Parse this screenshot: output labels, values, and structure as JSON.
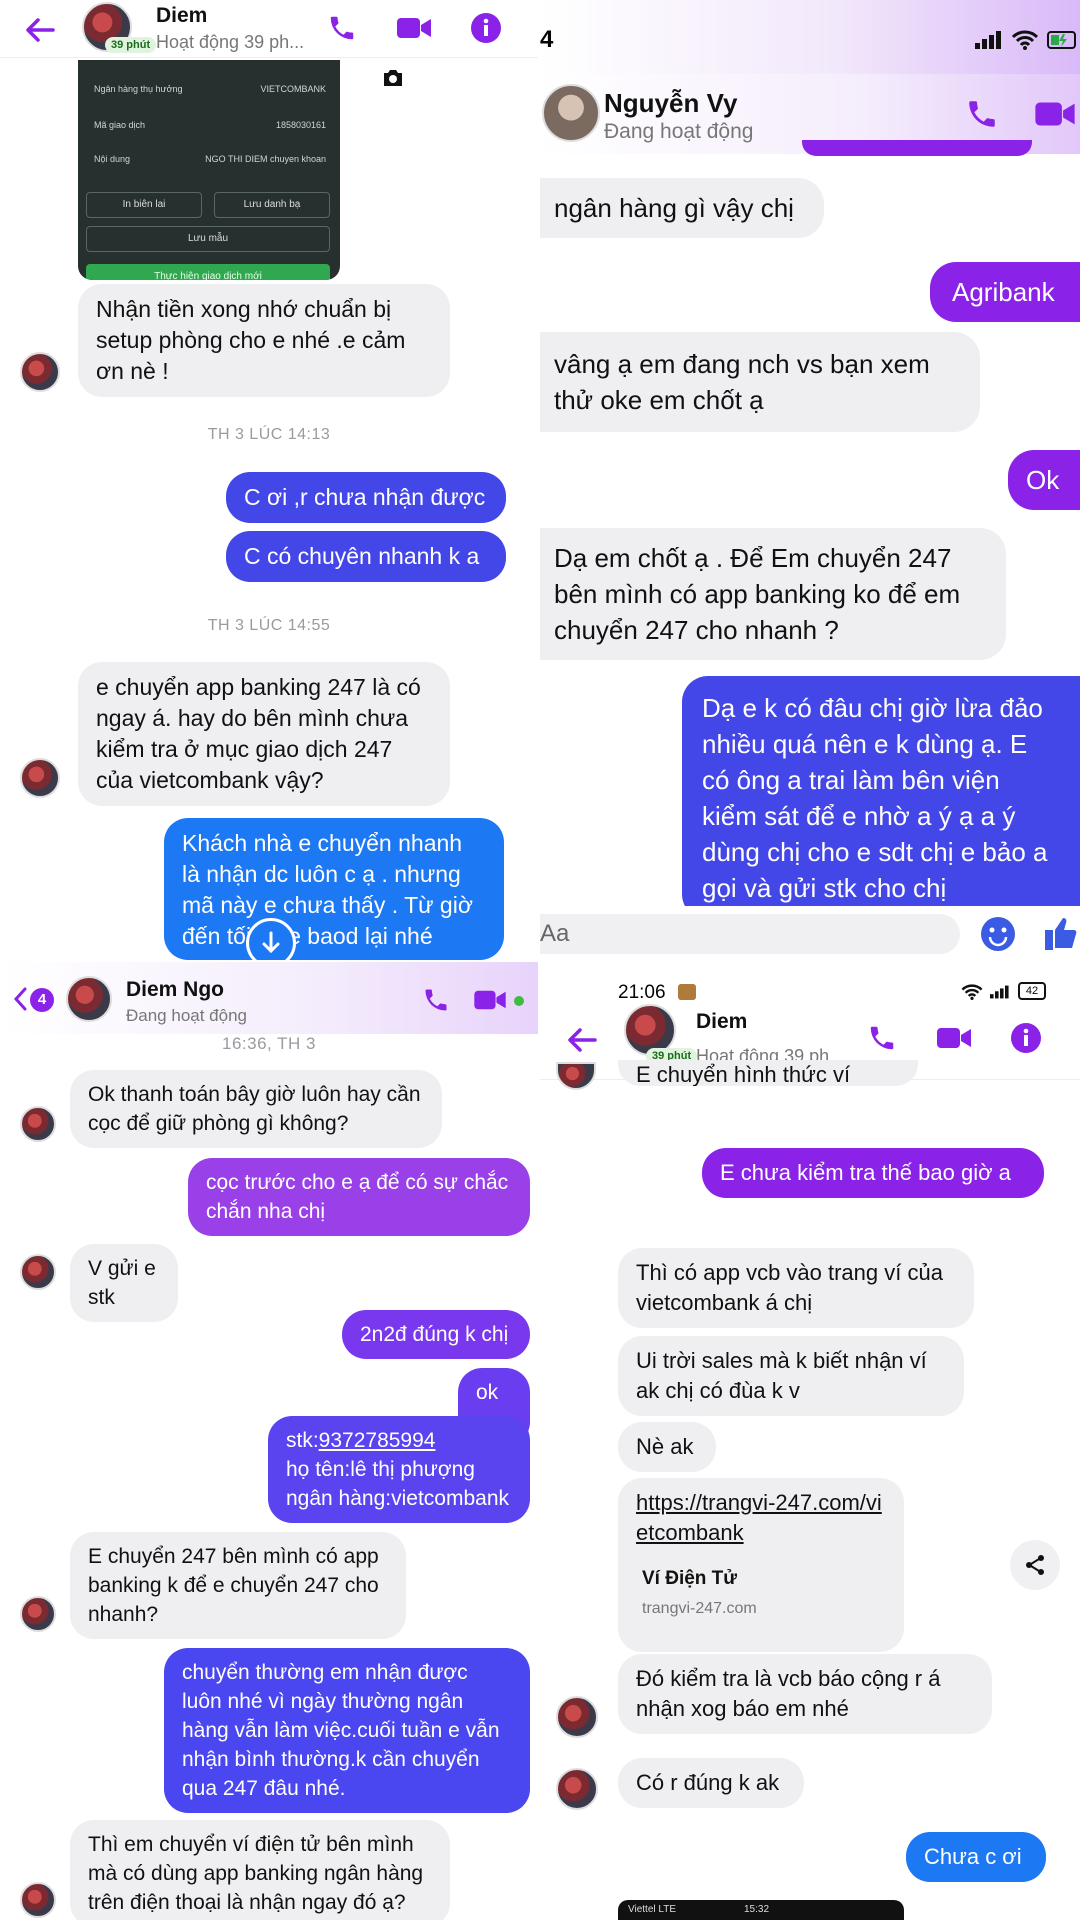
{
  "p1": {
    "header": {
      "name": "Diem",
      "badge": "39 phút",
      "status": "Hoạt động 39 ph..."
    },
    "receipt": {
      "rows": [
        {
          "label": "Ngân hàng thụ hưởng",
          "value": "VIETCOMBANK"
        },
        {
          "label": "Mã giao dịch",
          "value": "1858030161"
        },
        {
          "label": "Nội dung",
          "value": "NGO THI DIEM chuyen khoan"
        }
      ],
      "btn_reprint": "In biên lai",
      "btn_save_contact": "Lưu danh bạ",
      "btn_save_template": "Lưu mẫu",
      "btn_new": "Thực hiện giao dịch mới"
    },
    "messages": {
      "m1": "Nhận tiền xong nhớ chuẩn bị setup phòng cho e nhé .e cảm ơn nè !",
      "t1": "TH 3 LÚC 14:13",
      "m2": "C ơi ,r chưa nhận được",
      "m3": "C có chuyên nhanh k a",
      "t2": "TH 3 LÚC 14:55",
      "m4": "e chuyển app banking 247 là có ngay á. hay do bên mình chưa kiểm tra ở mục giao dịch 247 của vietcombank vậy?",
      "m5": "Khách nhà e chuyển nhanh là nhận dc luôn c ạ . nhưng mã này e chưa thấy . Từ giờ đến tối ấy e baod lại nhé"
    }
  },
  "p2": {
    "status_time": "4",
    "header": {
      "name": "Nguyễn Vy",
      "status": "Đang hoạt động"
    },
    "messages": {
      "m1": "ngân hàng gì vậy chị",
      "m2": "Agribank",
      "m3": "vâng ạ em đang nch vs bạn xem thử oke em chốt ạ",
      "m4": "Ok",
      "m5": "Dạ em chốt ạ . Để Em chuyển 247 bên mình có app banking ko để em chuyển 247 cho nhanh ?",
      "m6": "Dạ e k có đâu chị giờ lừa đảo nhiều quá nên e k dùng ạ. E có ông a trai làm bên viện kiểm sát để e nhờ a ý ạ a ý dùng chị cho e sdt chị e bảo a gọi và gửi stk cho chị"
    },
    "input_placeholder": "Aa"
  },
  "p3": {
    "header": {
      "back_count": "4",
      "name": "Diem Ngo",
      "status": "Đang hoạt động"
    },
    "messages": {
      "t1": "16:36, TH 3",
      "m1": "Ok thanh toán bây giờ luôn hay cần cọc để giữ phòng gì không?",
      "m2": "cọc trước cho e ạ để có sự chắc chắn nha chị",
      "m3": "V gửi e stk",
      "m4": "2n2đ đúng k chị",
      "m5": "ok c",
      "m6_prefix": "stk:",
      "m6_account": "9372785994",
      "m6_name": "họ tên:lê thị phượng",
      "m6_bank": "ngân hàng:vietcombank",
      "m7": "E chuyển 247 bên mình có app banking k để e chuyển 247 cho nhanh?",
      "m8": "chuyển thường em nhận được luôn nhé vì ngày thường ngân hàng vẫn làm việc.cuối tuần e vẫn nhận bình thường.k cần chuyển qua 247 đâu nhé.",
      "m9": "Thì em chuyển ví điện tử bên mình mà có dùng app banking ngân hàng trên điện thoại là nhận ngay đó ạ?"
    }
  },
  "p4": {
    "status_time": "21:06",
    "battery": "42",
    "header": {
      "name": "Diem",
      "badge": "39 phút",
      "status": "Hoạt động 39 ph..."
    },
    "messages": {
      "m0": "E chuyển hình thức ví",
      "m1": "E chưa kiểm tra thế bao giờ a",
      "m2": "Thì có app vcb vào trang ví của vietcombank á chị",
      "m3": "Ui trời sales mà k biết nhận ví ak chị có đùa k v",
      "m4": "Nè ak",
      "m5_link": "https://trangvi-247.com/vietcombank",
      "m5_title": "Ví Điện Tử",
      "m5_domain": "trangvi-247.com",
      "m6": "Đó kiểm tra là vcb báo cộng r á nhận xog báo em nhé",
      "m7": "Có r đúng k ak",
      "m8": "Chưa c ơi"
    },
    "bottom_bar": {
      "carrier": "Viettel LTE",
      "time": "15:32"
    }
  },
  "colors": {
    "messenger_purple": "#8a22e8",
    "messenger_blue": "#4447e8",
    "incoming_grey": "#efeff1"
  }
}
